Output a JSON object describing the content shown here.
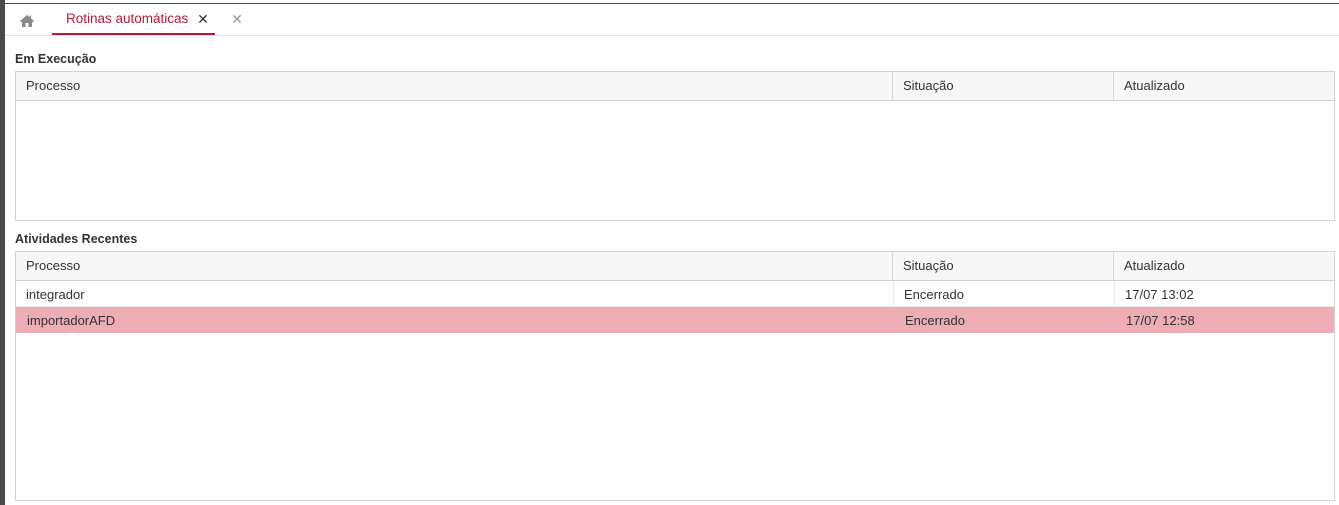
{
  "tabs": {
    "home_icon": "home-icon",
    "active_tab_label": "Rotinas automáticas",
    "close_glyph": "✕",
    "close_all_glyph": "✕"
  },
  "em_execucao": {
    "title": "Em Execução",
    "columns": [
      "Processo",
      "Situação",
      "Atualizado"
    ],
    "rows": []
  },
  "atividades_recentes": {
    "title": "Atividades Recentes",
    "columns": [
      "Processo",
      "Situação",
      "Atualizado"
    ],
    "rows": [
      {
        "processo": "integrador",
        "situacao": "Encerrado",
        "atualizado": "17/07 13:02"
      },
      {
        "processo": "importadorAFD",
        "situacao": "Encerrado",
        "atualizado": "17/07 12:58"
      }
    ]
  },
  "colors": {
    "accent": "#b5193a",
    "selected_row": "#eeadb5",
    "header_bg": "#f7f7f7",
    "border": "#d4d4d4"
  }
}
